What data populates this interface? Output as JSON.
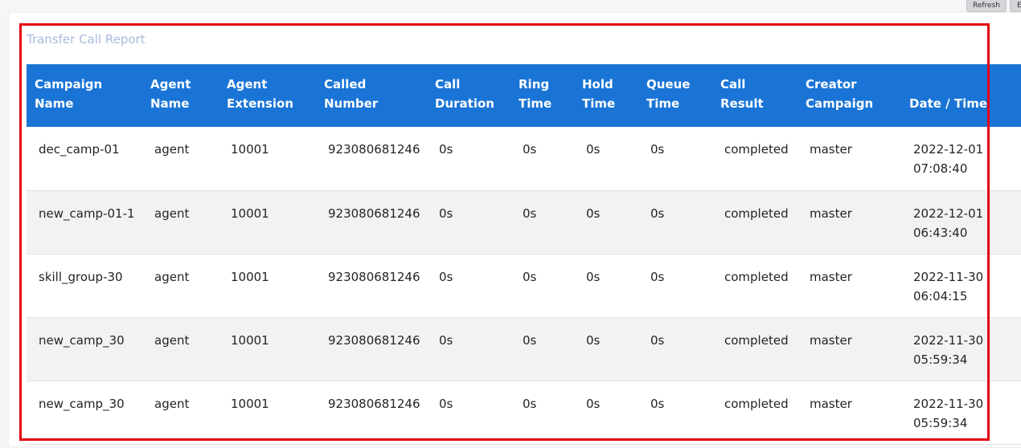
{
  "toolbar": {
    "refresh_label": "Refresh",
    "export_label": "E"
  },
  "report": {
    "title": "Transfer Call Report"
  },
  "table": {
    "headers": [
      [
        "Campaign Name"
      ],
      [
        "Agent",
        "Name"
      ],
      [
        "Agent",
        "Extension"
      ],
      [
        "Called Number"
      ],
      [
        "Call",
        "Duration"
      ],
      [
        "Ring",
        "Time"
      ],
      [
        "Hold",
        "Time"
      ],
      [
        "Queue",
        "Time"
      ],
      [
        "Call Result"
      ],
      [
        "Creator",
        "Campaign"
      ],
      [
        "Date / Time"
      ]
    ],
    "rows": [
      {
        "campaign_name": "dec_camp-01",
        "agent_name": "agent",
        "agent_extension": "10001",
        "called_number": "923080681246",
        "call_duration": "0s",
        "ring_time": "0s",
        "hold_time": "0s",
        "queue_time": "0s",
        "call_result": "completed",
        "creator_campaign": "master",
        "date": "2022-12-01",
        "time": "07:08:40"
      },
      {
        "campaign_name": "new_camp-01-1",
        "agent_name": "agent",
        "agent_extension": "10001",
        "called_number": "923080681246",
        "call_duration": "0s",
        "ring_time": "0s",
        "hold_time": "0s",
        "queue_time": "0s",
        "call_result": "completed",
        "creator_campaign": "master",
        "date": "2022-12-01",
        "time": "06:43:40"
      },
      {
        "campaign_name": "skill_group-30",
        "agent_name": "agent",
        "agent_extension": "10001",
        "called_number": "923080681246",
        "call_duration": "0s",
        "ring_time": "0s",
        "hold_time": "0s",
        "queue_time": "0s",
        "call_result": "completed",
        "creator_campaign": "master",
        "date": "2022-11-30",
        "time": "06:04:15"
      },
      {
        "campaign_name": "new_camp_30",
        "agent_name": "agent",
        "agent_extension": "10001",
        "called_number": "923080681246",
        "call_duration": "0s",
        "ring_time": "0s",
        "hold_time": "0s",
        "queue_time": "0s",
        "call_result": "completed",
        "creator_campaign": "master",
        "date": "2022-11-30",
        "time": "05:59:34"
      },
      {
        "campaign_name": "new_camp_30",
        "agent_name": "agent",
        "agent_extension": "10001",
        "called_number": "923080681246",
        "call_duration": "0s",
        "ring_time": "0s",
        "hold_time": "0s",
        "queue_time": "0s",
        "call_result": "completed",
        "creator_campaign": "master",
        "date": "2022-11-30",
        "time": "05:59:34"
      }
    ]
  },
  "colors": {
    "header_bg": "#1a74d6",
    "highlight_border": "#e60012",
    "title_text": "#a9b9dd"
  }
}
